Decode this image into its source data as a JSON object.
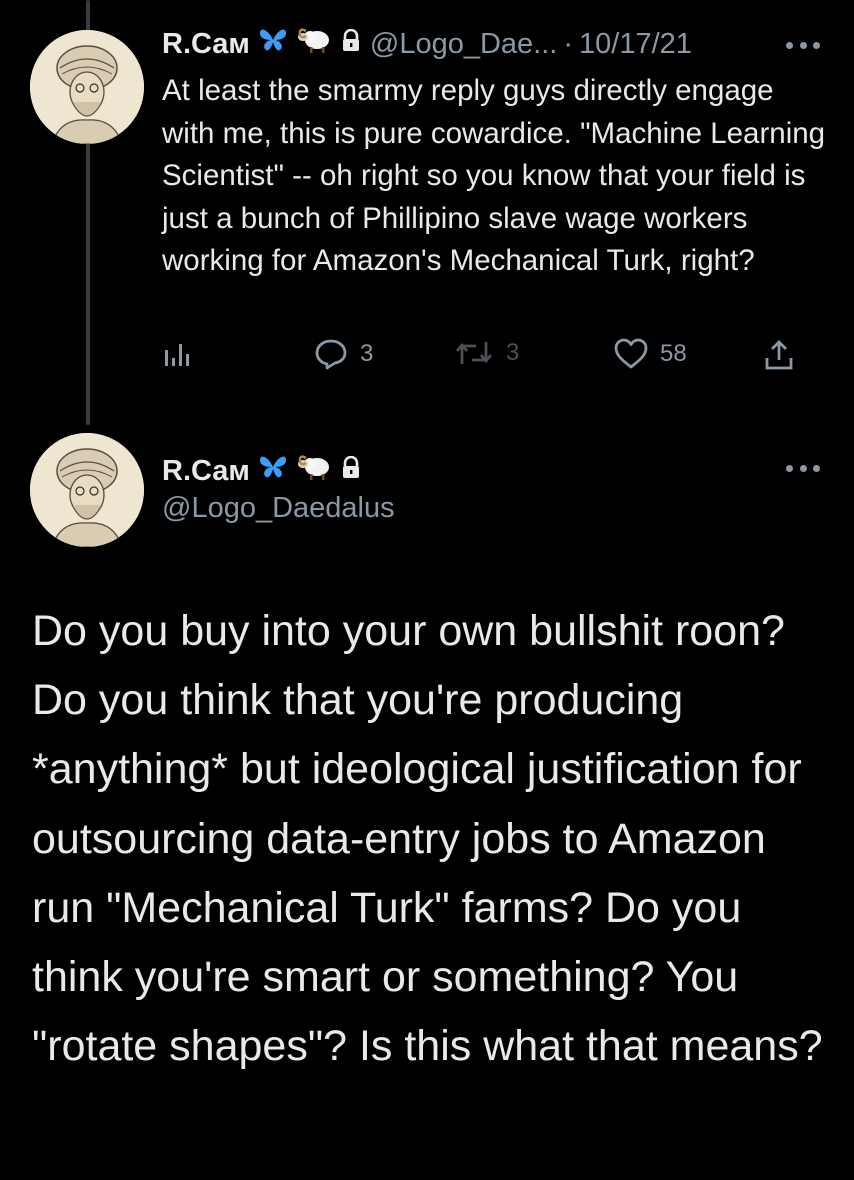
{
  "tweet1": {
    "display_name": "R.Сам",
    "badges": [
      "butterfly-emoji",
      "ram-emoji",
      "lock-icon"
    ],
    "handle": "@Logo_Dae...",
    "separator": "·",
    "date": "10/17/21",
    "text": "At least the smarmy reply guys directly engage with me, this is pure cowardice. \"Machine Learning Scientist\" -- oh right so you know that your field is just a bunch of Phillipino slave wage workers working for Amazon's Mechanical Turk, right?",
    "actions": {
      "views_icon": "analytics-icon",
      "replies": "3",
      "retweets": "3",
      "likes": "58",
      "share_icon": "share-icon"
    }
  },
  "tweet2": {
    "display_name": "R.Сам",
    "badges": [
      "butterfly-emoji",
      "ram-emoji",
      "lock-icon"
    ],
    "handle": "@Logo_Daedalus",
    "text": "Do you buy into your own bullshit roon? Do you think that you're producing *anything* but ideological justification for outsourcing data-entry jobs to Amazon run \"Mechanical Turk\" farms? Do you think you're smart or something? You \"rotate shapes\"? Is this what that means?"
  },
  "colors": {
    "background": "#000000",
    "text_primary": "#e7e9ea",
    "text_secondary": "#8b98a5",
    "butterfly": "#3b9df8",
    "thread_line": "#3a3d40"
  }
}
